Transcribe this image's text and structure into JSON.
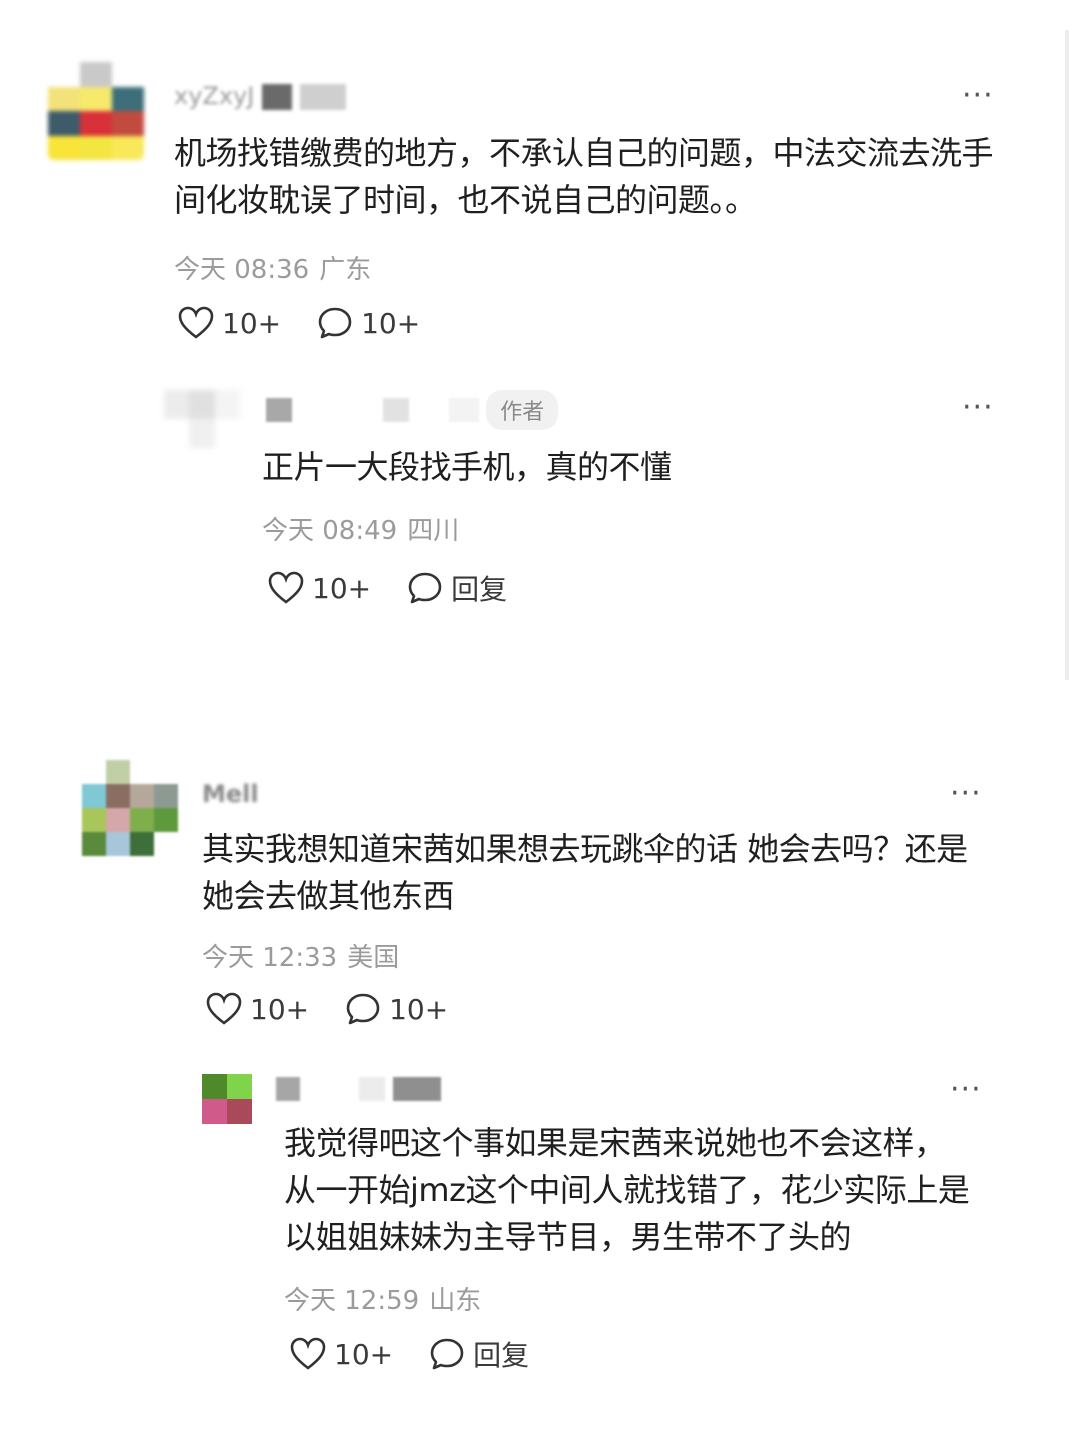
{
  "comments": [
    {
      "username": "xyZxyJ",
      "text": "机场找错缴费的地方，不承认自己的问题，中法交流去洗手间化妆耽误了时间，也不说自己的问题。。",
      "time": "今天 08:36",
      "location": "广东",
      "likes": "10+",
      "replies": "10+",
      "avatar_colors": [
        "#ffffff",
        "#c9c9c9",
        "#ffffff",
        "#f3e27a",
        "#f6e96c",
        "#3c6f7a",
        "#3e5b6a",
        "#d8313a",
        "#c24b3f",
        "#f9e43a",
        "#f4e640",
        "#f8e85a"
      ]
    },
    {
      "username": "",
      "badge": "作者",
      "text": "正片一大段找手机，真的不懂",
      "time": "今天 08:49",
      "location": "四川",
      "likes": "10+",
      "reply_label": "回复"
    },
    {
      "username": "Mell",
      "text": "其实我想知道宋茜如果想去玩跳伞的话 她会去吗？还是她会去做其他东西",
      "time": "今天 12:33",
      "location": "美国",
      "likes": "10+",
      "replies": "10+",
      "avatar_colors": [
        "#ffffff",
        "#c2cfa6",
        "#ffffff",
        "#ffffff",
        "#7fc8d4",
        "#8a6e62",
        "#b5a89a",
        "#8c9a92",
        "#a8c65a",
        "#d4a8a8",
        "#7fae4c",
        "#5e9a3c",
        "#5a8a3c",
        "#a8c6da",
        "#3e6e3a",
        "#ffffff"
      ]
    },
    {
      "username": "",
      "text": "我觉得吧这个事如果是宋茜来说她也不会这样，从一开始jmz这个中间人就找错了，花少实际上是以姐姐妹妹为主导节目，男生带不了头的",
      "time": "今天 12:59",
      "location": "山东",
      "likes": "10+",
      "reply_label": "回复",
      "avatar_colors": [
        "#4f8a2a",
        "#7fd44a",
        "#d05a8a",
        "#a84a5a"
      ]
    }
  ],
  "more_label": "···"
}
